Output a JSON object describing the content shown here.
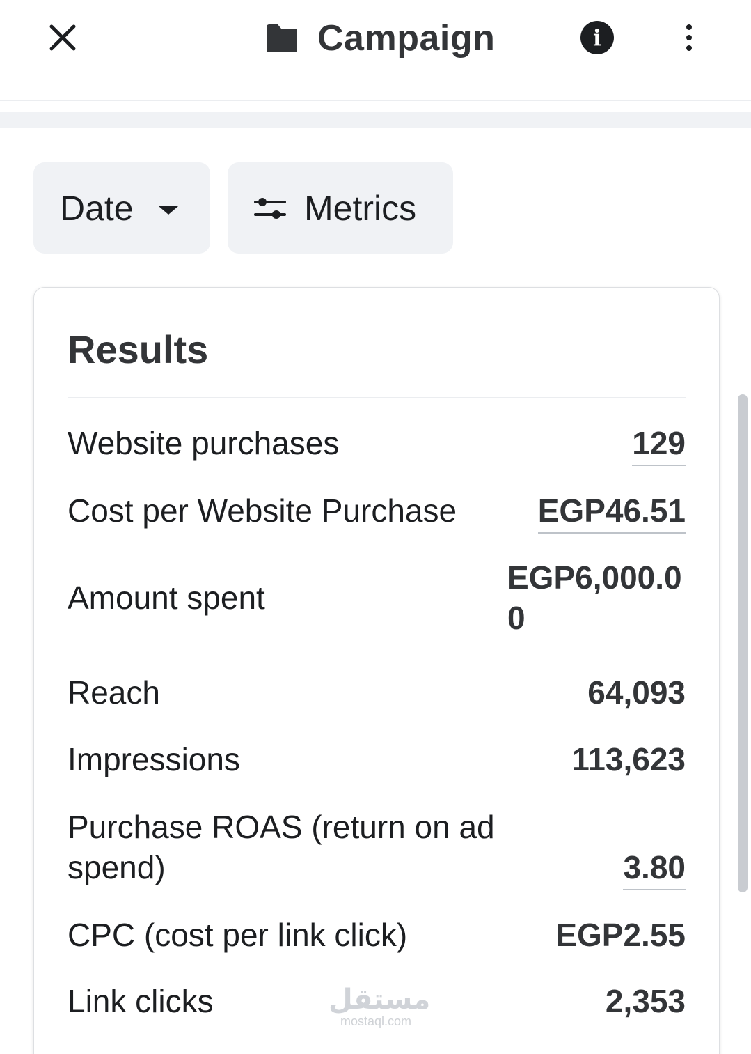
{
  "header": {
    "title": "Campaign",
    "icons": {
      "close": "close-icon",
      "folder": "folder-icon",
      "info": "info-icon",
      "more": "more-vertical-icon"
    }
  },
  "filters": {
    "date_label": "Date",
    "metrics_label": "Metrics"
  },
  "results": {
    "title": "Results",
    "rows": [
      {
        "label": "Website purchases",
        "value": "129",
        "underlined": true
      },
      {
        "label": "Cost per Website Purchase",
        "value": "EGP46.51",
        "underlined": true
      },
      {
        "label": "Amount spent",
        "value_line1": "EGP6,000.0",
        "value_line2": "0",
        "underlined": false
      },
      {
        "label": "Reach",
        "value": "64,093",
        "underlined": false
      },
      {
        "label": "Impressions",
        "value": "113,623",
        "underlined": false
      },
      {
        "label_line1": "Purchase ROAS (return on ad",
        "label_line2": "spend)",
        "value": "3.80",
        "underlined": true
      },
      {
        "label": "CPC (cost per link click)",
        "value": "EGP2.55",
        "underlined": false
      },
      {
        "label": "Link clicks",
        "value": "2,353",
        "underlined": false
      }
    ]
  },
  "watermark": {
    "arabic": "مستقل",
    "latin": "mostaql.com"
  },
  "colors": {
    "chip_bg": "#f0f2f5",
    "text_primary": "#1c1e21",
    "text_heading": "#333538",
    "divider": "#ebedf0"
  }
}
